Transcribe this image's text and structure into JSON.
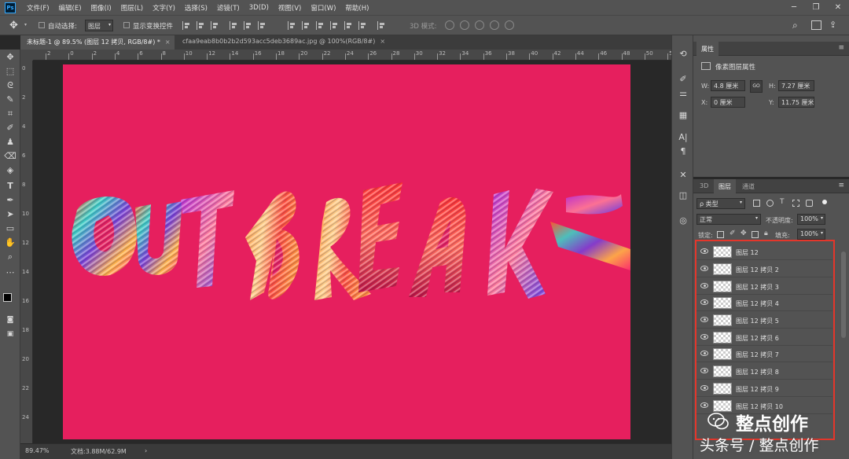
{
  "app": {
    "name": "Photoshop",
    "logo_text": "Ps"
  },
  "menubar": {
    "items": [
      "文件(F)",
      "编辑(E)",
      "图像(I)",
      "图层(L)",
      "文字(Y)",
      "选择(S)",
      "滤镜(T)",
      "3D(D)",
      "视图(V)",
      "窗口(W)",
      "帮助(H)"
    ]
  },
  "window_controls": {
    "minimize": "─",
    "restore": "❐",
    "close": "✕"
  },
  "options": {
    "auto_select_label": "自动选择:",
    "auto_select_value": "图层",
    "show_transform_label": "显示变换控件",
    "mode_3d_label": "3D 模式:"
  },
  "tabs": [
    {
      "label": "未标题-1 @ 89.5% (图层 12 拷贝, RGB/8#) *",
      "close": "×"
    },
    {
      "label": "cfaa9eab8b0b2b2d593acc5deb3689ac.jpg @ 100%(RGB/8#)",
      "close": "×"
    }
  ],
  "rulers": {
    "horizontal": [
      "2",
      "0",
      "2",
      "4",
      "6",
      "8",
      "10",
      "12",
      "14",
      "16",
      "18",
      "20",
      "22",
      "24",
      "26",
      "28",
      "30",
      "32",
      "34",
      "36",
      "38",
      "40",
      "42",
      "44",
      "46",
      "48",
      "50",
      "52"
    ],
    "vertical": [
      "0",
      "2",
      "4",
      "6",
      "8",
      "10",
      "12",
      "14",
      "16",
      "18",
      "20",
      "22",
      "24"
    ]
  },
  "canvas": {
    "background": "#e61f5e",
    "artwork_text": "OUTBREAK"
  },
  "status": {
    "zoom": "89.47%",
    "doc": "文档:3.88M/62.9M",
    "arrow": "›"
  },
  "properties": {
    "tab": "属性",
    "title": "像素图层属性",
    "w_label": "W:",
    "w_value": "4.8 厘米",
    "h_label": "H:",
    "h_value": "7.27 厘米",
    "x_label": "X:",
    "x_value": "0 厘米",
    "y_label": "Y:",
    "y_value": "11.75 厘米",
    "link_label": "GO"
  },
  "layers_panel": {
    "tabs": [
      "3D",
      "图层",
      "通道"
    ],
    "filter_label": "ρ 类型",
    "blend_mode": "正常",
    "opacity_label": "不透明度:",
    "opacity_value": "100%",
    "lock_label": "锁定:",
    "fill_label": "填充:",
    "fill_value": "100%",
    "layers": [
      "图层 12",
      "图层 12 拷贝 2",
      "图层 12 拷贝 3",
      "图层 12 拷贝 4",
      "图层 12 拷贝 5",
      "图层 12 拷贝 6",
      "图层 12 拷贝 7",
      "图层 12 拷贝 8",
      "图层 12 拷贝 9",
      "图层 12 拷贝 10"
    ]
  },
  "watermark": {
    "line1": "整点创作",
    "line2": "头条号 / 整点创作"
  },
  "colors": {
    "ui_panel": "#535353",
    "highlight_box": "#e4362b",
    "canvas_fill": "#e61f5e"
  }
}
